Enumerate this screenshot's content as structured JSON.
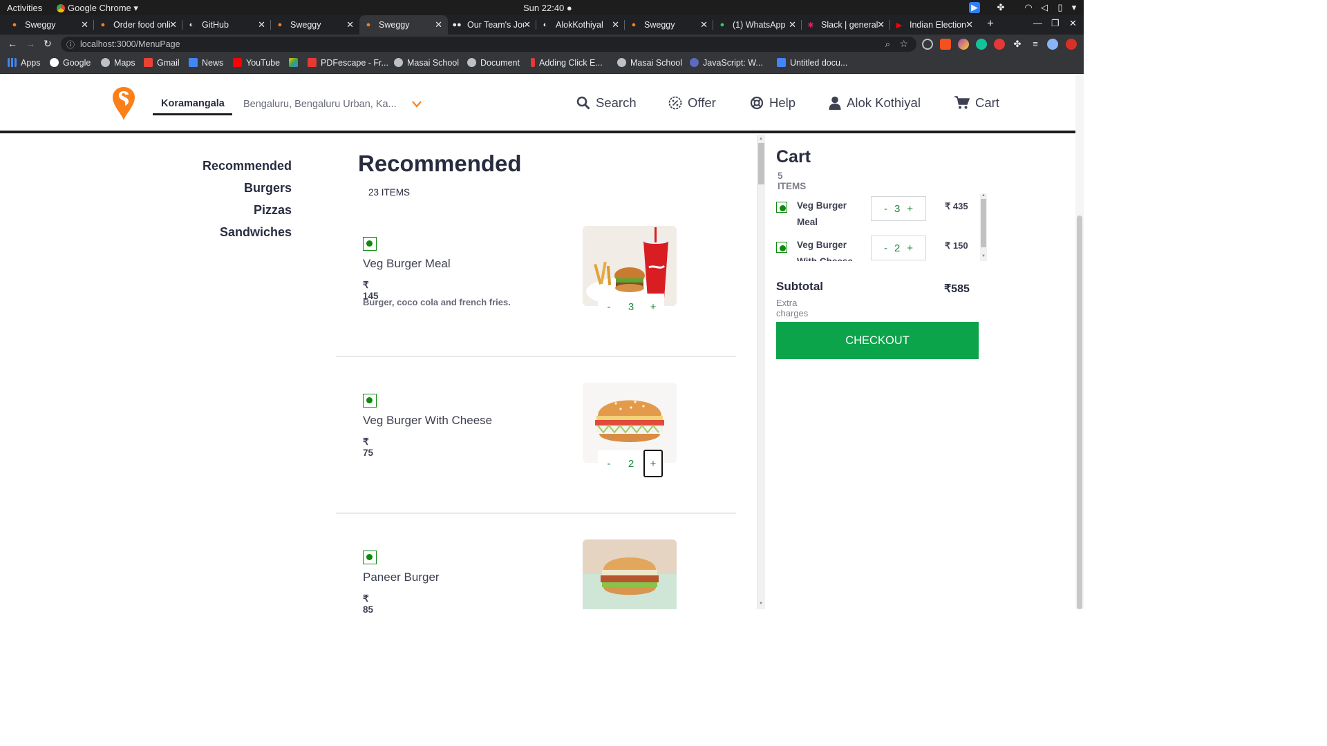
{
  "system": {
    "activities": "Activities",
    "app_name": "Google Chrome",
    "clock": "Sun 22:40"
  },
  "tabs": [
    {
      "title": "Sweggy",
      "icon": "sweggy-favicon"
    },
    {
      "title": "Order food online",
      "icon": "swiggy-favicon"
    },
    {
      "title": "GitHub",
      "icon": "github-favicon"
    },
    {
      "title": "Sweggy",
      "icon": "sweggy-favicon"
    },
    {
      "title": "Sweggy",
      "icon": "sweggy-favicon",
      "active": true
    },
    {
      "title": "Our Team's Journey",
      "icon": "medium-favicon"
    },
    {
      "title": "AlokKothiyal",
      "icon": "github-favicon"
    },
    {
      "title": "Sweggy",
      "icon": "sweggy-favicon"
    },
    {
      "title": "(1) WhatsApp",
      "icon": "whatsapp-favicon"
    },
    {
      "title": "Slack | general",
      "icon": "slack-favicon"
    },
    {
      "title": "Indian Elections",
      "icon": "youtube-favicon"
    }
  ],
  "omnibox": {
    "url": "localhost:3000/MenuPage"
  },
  "bookmarks": [
    {
      "label": "Apps",
      "color": "#4285f4"
    },
    {
      "label": "Google",
      "color": "#ffffff"
    },
    {
      "label": "Maps",
      "color": "#bdc1c6"
    },
    {
      "label": "Gmail",
      "color": "#ea4335"
    },
    {
      "label": "News",
      "color": "#4285f4"
    },
    {
      "label": "YouTube",
      "color": "#ff0000"
    },
    {
      "label": "",
      "color": "#34a853"
    },
    {
      "label": "PDFescape - Fr...",
      "color": "#e53935"
    },
    {
      "label": "Masai School",
      "color": "#bdc1c6"
    },
    {
      "label": "Document",
      "color": "#bdc1c6"
    },
    {
      "label": "Adding Click E...",
      "color": "#e53935"
    },
    {
      "label": "Masai School",
      "color": "#bdc1c6"
    },
    {
      "label": "JavaScript: W...",
      "color": "#5c6bc0"
    },
    {
      "label": "Untitled docu...",
      "color": "#4285f4"
    }
  ],
  "header": {
    "location_primary": "Koramangala",
    "location_secondary": "Bengaluru, Bengaluru Urban, Ka...",
    "nav": {
      "search": "Search",
      "offer": "Offer",
      "help": "Help",
      "user": "Alok Kothiyal",
      "cart": "Cart"
    },
    "brand_color": "#fc8019"
  },
  "categories": [
    "Recommended",
    "Burgers",
    "Pizzas",
    "Sandwiches"
  ],
  "section": {
    "title": "Recommended",
    "count": "23 ITEMS"
  },
  "menu_items": [
    {
      "name": "Veg Burger Meal",
      "price": "₹ 145",
      "desc": "Burger, coco cola and french fries.",
      "qty": "3",
      "minus": "-",
      "plus": "+"
    },
    {
      "name": "Veg Burger With Cheese",
      "price": "₹ 75",
      "desc": "",
      "qty": "2",
      "minus": "-",
      "plus": "+"
    },
    {
      "name": "Paneer Burger",
      "price": "₹ 85",
      "desc": ""
    }
  ],
  "cart": {
    "title": "Cart",
    "count": "5 ITEMS",
    "items": [
      {
        "name": "Veg Burger Meal",
        "qty": "3",
        "price": "₹ 435",
        "minus": "-",
        "plus": "+"
      },
      {
        "name": "Veg Burger With Cheese",
        "qty": "2",
        "price": "₹ 150",
        "minus": "-",
        "plus": "+"
      }
    ],
    "subtotal_label": "Subtotal",
    "subtotal_value": "₹585",
    "extra_note": "Extra charges may apply",
    "checkout_label": "CHECKOUT",
    "checkout_color": "#0ca44a"
  }
}
